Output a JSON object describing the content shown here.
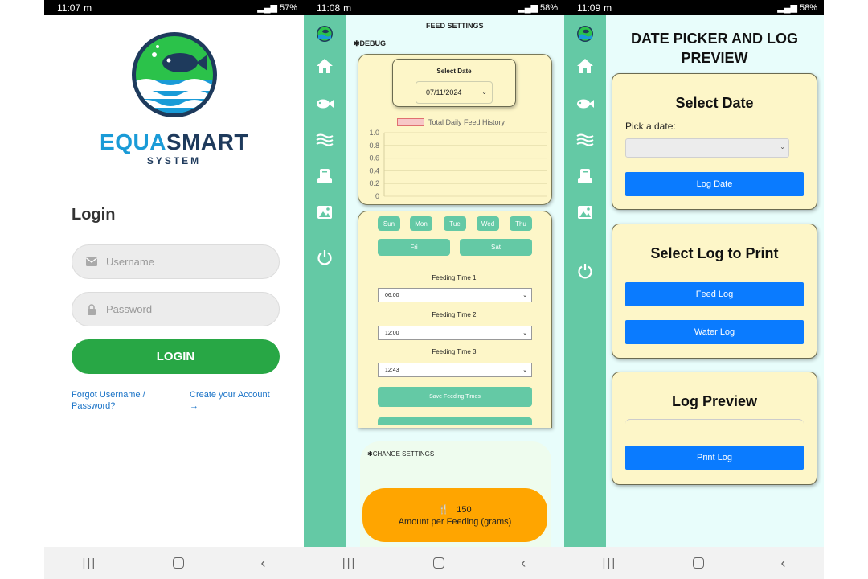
{
  "screens": [
    {
      "status": {
        "time": "11:07",
        "extra": "m",
        "battery": "57%"
      },
      "logo": {
        "brand_part1": "EQUA",
        "brand_part2": "SMART",
        "sub": "SYSTEM"
      },
      "login": {
        "title": "Login",
        "username_placeholder": "Username",
        "password_placeholder": "Password",
        "button": "LOGIN",
        "forgot_line1": "Forgot Username /",
        "forgot_line2": "Password?",
        "create_line1": "Create your Account",
        "create_arrow": "→"
      }
    },
    {
      "status": {
        "time": "11:08",
        "extra": "m",
        "battery": "58%"
      },
      "title": "FEED SETTINGS",
      "debug": "DEBUG",
      "date_label": "Select Date",
      "date_value": "07/11/2024",
      "legend": "Total Daily Feed History",
      "days": [
        "Sun",
        "Mon",
        "Tue",
        "Wed",
        "Thu",
        "Fri",
        "Sat"
      ],
      "feeding": [
        {
          "label": "Feeding Time 1:",
          "value": "06:00"
        },
        {
          "label": "Feeding Time 2:",
          "value": "12:00"
        },
        {
          "label": "Feeding Time 3:",
          "value": "12:43"
        }
      ],
      "save_btn": "Save Feeding Times",
      "change_settings": "CHANGE SETTINGS",
      "amount_value": "150",
      "amount_label": "Amount per Feeding (grams)"
    },
    {
      "status": {
        "time": "11:09",
        "extra": "m",
        "battery": "58%"
      },
      "title_line1": "DATE PICKER AND LOG",
      "title_line2": "PREVIEW",
      "select_date": "Select Date",
      "pick_label": "Pick a date:",
      "log_date_btn": "Log Date",
      "select_log": "Select Log to Print",
      "feed_log_btn": "Feed Log",
      "water_log_btn": "Water Log",
      "log_preview": "Log Preview",
      "print_btn": "Print Log"
    }
  ],
  "chart_data": {
    "type": "line",
    "series": [
      {
        "name": "Total Daily Feed History",
        "values": []
      }
    ],
    "y_ticks": [
      "1.0",
      "0.8",
      "0.6",
      "0.4",
      "0.2",
      "0"
    ],
    "ylim": [
      0,
      1.0
    ],
    "grid": true,
    "legend": "top"
  },
  "colors": {
    "rail": "#64c9a5",
    "login_green": "#28a745",
    "blue": "#0a7bff",
    "card_yellow": "#fdf6c8",
    "orange": "#ffa500",
    "legend_fill": "#f7c7c7"
  },
  "icons": [
    "home-icon",
    "fish-icon",
    "water-icon",
    "log-icon",
    "image-icon",
    "power-icon",
    "gear-icon",
    "mail-icon",
    "lock-icon"
  ]
}
